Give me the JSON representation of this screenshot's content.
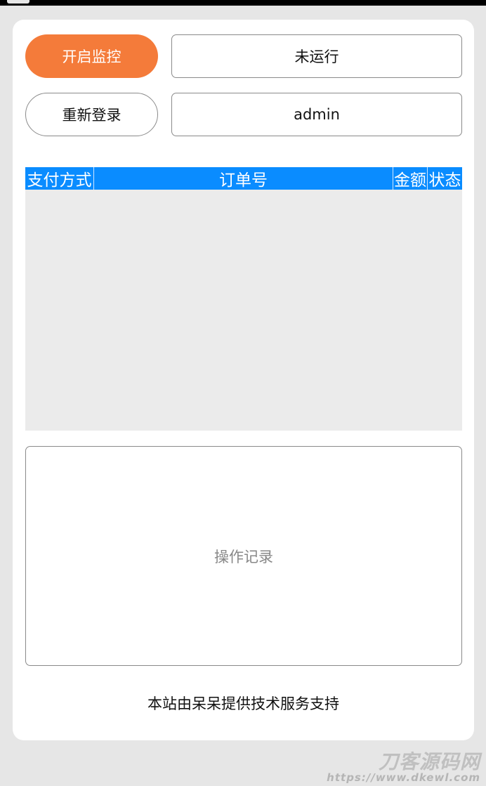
{
  "controls": {
    "start_button": "开启监控",
    "run_status": "未运行",
    "relogin_button": "重新登录",
    "username": "admin"
  },
  "table": {
    "columns": [
      "支付方式",
      "订单号",
      "金额",
      "状态"
    ],
    "rows": []
  },
  "log": {
    "placeholder": "操作记录"
  },
  "footer": {
    "text": "本站由呆呆提供技术服务支持"
  },
  "watermark": {
    "logo_text": "刀客源码网",
    "url": "https://www.dkewl.com"
  },
  "colors": {
    "accent_orange": "#f47b3a",
    "table_header_blue": "#0a8cff",
    "background": "#e6e6e6",
    "card": "#ffffff"
  }
}
